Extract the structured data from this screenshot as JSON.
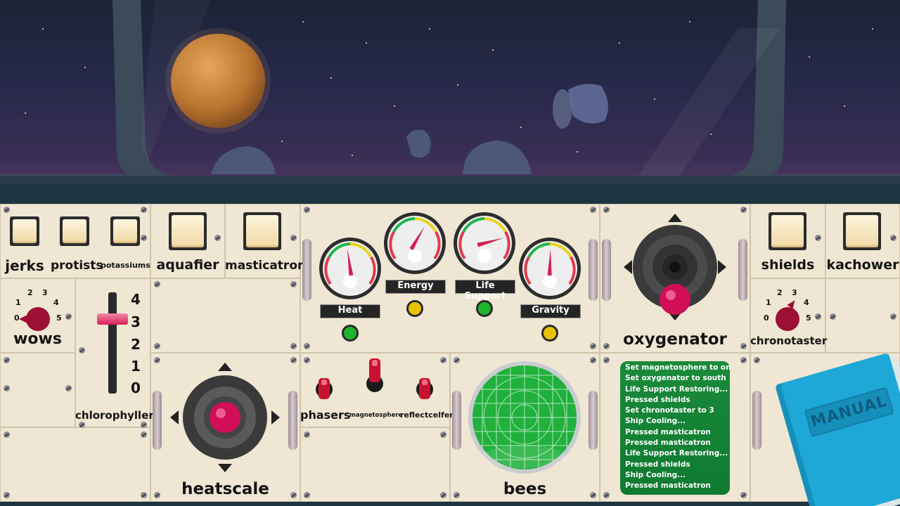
{
  "buttons": {
    "jerks": "jerks",
    "protists": "protists",
    "potassiums": "potassiums",
    "aquafier": "aquafier",
    "masticatron": "masticatron",
    "shields": "shields",
    "kachower": "kachower"
  },
  "dials": {
    "wows": {
      "label": "wows",
      "ticks": [
        "0",
        "1",
        "2",
        "3",
        "4",
        "5"
      ]
    },
    "chronotaster": {
      "label": "chronotaster",
      "ticks": [
        "0",
        "1",
        "2",
        "3",
        "4",
        "5"
      ]
    }
  },
  "slider": {
    "label": "chlorophyller",
    "ticks": [
      "4",
      "3",
      "2",
      "1",
      "0"
    ],
    "value": 3
  },
  "gauges": [
    {
      "name": "Heat",
      "lamp_color": "#1fb52b"
    },
    {
      "name": "Energy",
      "lamp_color": "#e8c400"
    },
    {
      "name": "Life Support",
      "lamp_color": "#1fb52b"
    },
    {
      "name": "Gravity",
      "lamp_color": "#e8c400"
    }
  ],
  "joysticks": {
    "oxygenator": "oxygenator",
    "heatscale": "heatscale"
  },
  "switches": {
    "phasers": "phasers",
    "magnetosphere": "magnetosphere",
    "reflectcelfer": "reflectcelfer"
  },
  "radar": {
    "label": "bees"
  },
  "log": [
    "Set magnetosphere to on",
    "Set oxygenator to south",
    "Life Support Restoring...",
    "Pressed shields",
    "Set chronotaster to 3",
    "Ship Cooling...",
    "Pressed masticatron",
    "Pressed masticatron",
    "Life Support Restoring...",
    "Pressed shields",
    "Ship Cooling...",
    "Pressed masticatron"
  ],
  "manual": {
    "title": "MANUAL"
  },
  "colors": {
    "panel": "#efe6d3",
    "accent_knob": "#e0105e",
    "radar": "#19b03a",
    "log_bg": "#0f7a30",
    "manual": "#1aa6d6"
  }
}
